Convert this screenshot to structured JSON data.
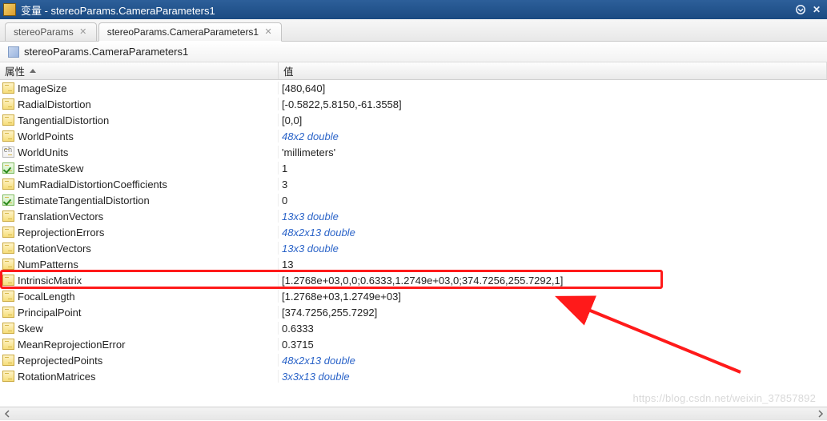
{
  "titlebar": {
    "label": "变量 - stereoParams.CameraParameters1"
  },
  "tabs": [
    {
      "label": "stereoParams",
      "active": false
    },
    {
      "label": "stereoParams.CameraParameters1",
      "active": true
    }
  ],
  "breadcrumb": {
    "label": "stereoParams.CameraParameters1"
  },
  "columns": {
    "name": "属性",
    "value": "值"
  },
  "rows": [
    {
      "icon": "struct",
      "name": "ImageSize",
      "value": "[480,640]",
      "link": false
    },
    {
      "icon": "struct",
      "name": "RadialDistortion",
      "value": "[-0.5822,5.8150,-61.3558]",
      "link": false
    },
    {
      "icon": "struct",
      "name": "TangentialDistortion",
      "value": "[0,0]",
      "link": false
    },
    {
      "icon": "struct",
      "name": "WorldPoints",
      "value": "48x2 double",
      "link": true
    },
    {
      "icon": "text",
      "name": "WorldUnits",
      "value": "'millimeters'",
      "link": false
    },
    {
      "icon": "check",
      "name": "EstimateSkew",
      "value": "1",
      "link": false
    },
    {
      "icon": "struct",
      "name": "NumRadialDistortionCoefficients",
      "value": "3",
      "link": false
    },
    {
      "icon": "check",
      "name": "EstimateTangentialDistortion",
      "value": "0",
      "link": false
    },
    {
      "icon": "struct",
      "name": "TranslationVectors",
      "value": "13x3 double",
      "link": true
    },
    {
      "icon": "struct",
      "name": "ReprojectionErrors",
      "value": "48x2x13 double",
      "link": true
    },
    {
      "icon": "struct",
      "name": "RotationVectors",
      "value": "13x3 double",
      "link": true
    },
    {
      "icon": "struct",
      "name": "NumPatterns",
      "value": "13",
      "link": false
    },
    {
      "icon": "struct",
      "name": "IntrinsicMatrix",
      "value": "[1.2768e+03,0,0;0.6333,1.2749e+03,0;374.7256,255.7292,1]",
      "link": false,
      "highlight": true
    },
    {
      "icon": "struct",
      "name": "FocalLength",
      "value": "[1.2768e+03,1.2749e+03]",
      "link": false
    },
    {
      "icon": "struct",
      "name": "PrincipalPoint",
      "value": "[374.7256,255.7292]",
      "link": false
    },
    {
      "icon": "struct",
      "name": "Skew",
      "value": "0.6333",
      "link": false
    },
    {
      "icon": "struct",
      "name": "MeanReprojectionError",
      "value": "0.3715",
      "link": false
    },
    {
      "icon": "struct",
      "name": "ReprojectedPoints",
      "value": "48x2x13 double",
      "link": true
    },
    {
      "icon": "struct",
      "name": "RotationMatrices",
      "value": "3x3x13 double",
      "link": true
    }
  ],
  "watermark": "https://blog.csdn.net/weixin_37857892"
}
